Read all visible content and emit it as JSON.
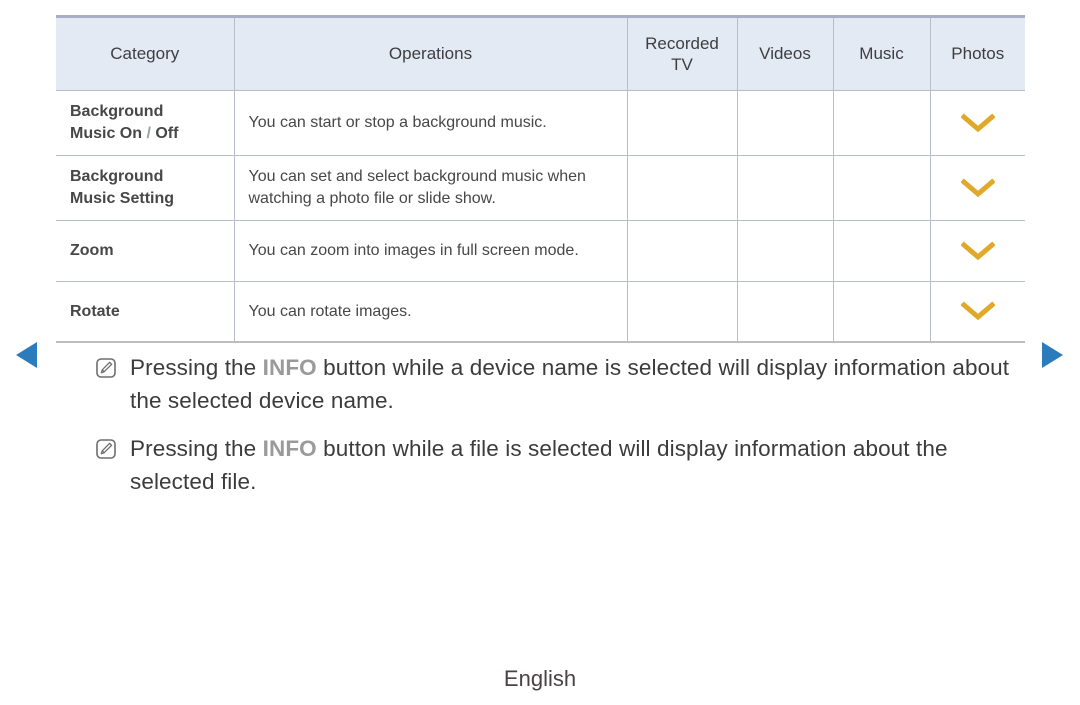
{
  "table": {
    "headers": [
      {
        "label": "Category"
      },
      {
        "label": "Operations"
      },
      {
        "label": "Recorded TV"
      },
      {
        "label": "Videos"
      },
      {
        "label": "Music"
      },
      {
        "label": "Photos"
      }
    ],
    "rows": [
      {
        "category_line1": "Background",
        "category_line2_a": "Music On",
        "category_sep": " / ",
        "category_line2_b": "Off",
        "operations": "You can start or stop a background music.",
        "recorded_tv": "",
        "videos": "",
        "music": "",
        "photos": "chevron-down-icon"
      },
      {
        "category_line1": "Background",
        "category_line2_a": "Music Setting",
        "category_sep": "",
        "category_line2_b": "",
        "operations": "You can set and select background music when watching a photo file or slide show.",
        "recorded_tv": "",
        "videos": "",
        "music": "",
        "photos": "chevron-down-icon"
      },
      {
        "category_line1": "Zoom",
        "category_line2_a": "",
        "category_sep": "",
        "category_line2_b": "",
        "operations": "You can zoom into images in full screen mode.",
        "recorded_tv": "",
        "videos": "",
        "music": "",
        "photos": "chevron-down-icon"
      },
      {
        "category_line1": "Rotate",
        "category_line2_a": "",
        "category_sep": "",
        "category_line2_b": "",
        "operations": "You can rotate images.",
        "recorded_tv": "",
        "videos": "",
        "music": "",
        "photos": "chevron-down-icon"
      }
    ]
  },
  "notes": [
    {
      "icon": "note-pencil-icon",
      "before": "Pressing the ",
      "keyword": "INFO",
      "after": " button while a device name is selected will display information about the selected device name."
    },
    {
      "icon": "note-pencil-icon",
      "before": "Pressing the ",
      "keyword": "INFO",
      "after": " button while a file is selected will display information about the selected file."
    }
  ],
  "navigation": {
    "prev_icon": "triangle-left-icon",
    "next_icon": "triangle-right-icon"
  },
  "footer": {
    "language": "English"
  },
  "colors": {
    "category_text": "#2a7ac4",
    "separator_text": "#9aa0a6",
    "chevron": "#e0a92a",
    "nav_arrow": "#2c7bbd",
    "header_background": "#e3eaf4",
    "header_top_border": "#a9adc6",
    "grid_line": "#b9bcc9",
    "keyword_text": "#9a9a9a",
    "body_text": "#3c3c3c"
  }
}
